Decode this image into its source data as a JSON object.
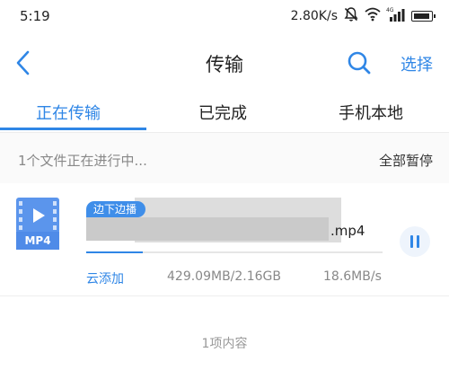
{
  "status_bar": {
    "time": "5:19",
    "network_speed": "2.80K/s",
    "icons": [
      "mute-icon",
      "wifi-icon",
      "signal-4g-icon",
      "battery-icon"
    ],
    "network_type": "4G"
  },
  "header": {
    "title": "传输",
    "select_label": "选择",
    "back_icon": "chevron-left-icon",
    "search_icon": "search-icon"
  },
  "tabs": [
    {
      "label": "正在传输",
      "active": true
    },
    {
      "label": "已完成",
      "active": false
    },
    {
      "label": "手机本地",
      "active": false
    }
  ],
  "section": {
    "status_text": "1个文件正在进行中...",
    "pause_all_label": "全部暂停"
  },
  "transfer": {
    "badge": "边下边播",
    "file_type": "MP4",
    "file_extension": ".mp4",
    "source_label": "云添加",
    "size_text": "429.09MB/2.16GB",
    "speed_text": "18.6MB/s",
    "progress": 0.19,
    "action_icon": "pause-icon"
  },
  "footer": {
    "count_text": "1项内容"
  },
  "colors": {
    "accent": "#2f86e6",
    "file_icon": "#4f8be8",
    "muted_text": "#888888"
  }
}
